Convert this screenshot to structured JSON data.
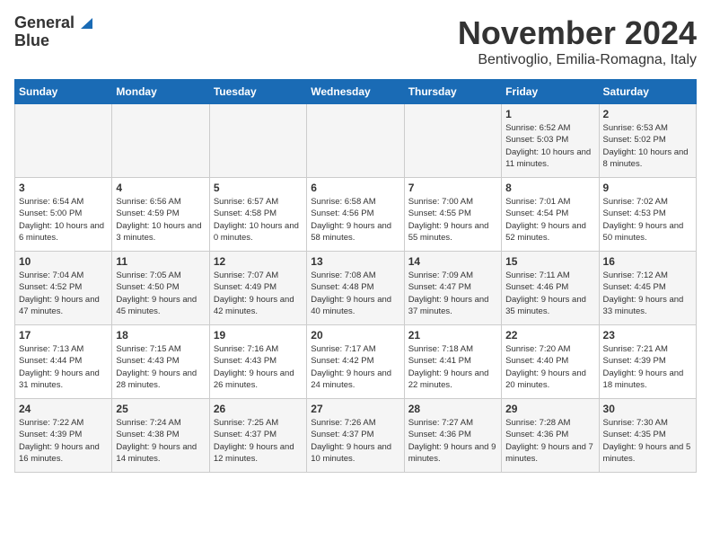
{
  "header": {
    "logo_line1": "General",
    "logo_line2": "Blue",
    "month": "November 2024",
    "location": "Bentivoglio, Emilia-Romagna, Italy"
  },
  "days_of_week": [
    "Sunday",
    "Monday",
    "Tuesday",
    "Wednesday",
    "Thursday",
    "Friday",
    "Saturday"
  ],
  "weeks": [
    [
      {
        "day": "",
        "info": ""
      },
      {
        "day": "",
        "info": ""
      },
      {
        "day": "",
        "info": ""
      },
      {
        "day": "",
        "info": ""
      },
      {
        "day": "",
        "info": ""
      },
      {
        "day": "1",
        "info": "Sunrise: 6:52 AM\nSunset: 5:03 PM\nDaylight: 10 hours and 11 minutes."
      },
      {
        "day": "2",
        "info": "Sunrise: 6:53 AM\nSunset: 5:02 PM\nDaylight: 10 hours and 8 minutes."
      }
    ],
    [
      {
        "day": "3",
        "info": "Sunrise: 6:54 AM\nSunset: 5:00 PM\nDaylight: 10 hours and 6 minutes."
      },
      {
        "day": "4",
        "info": "Sunrise: 6:56 AM\nSunset: 4:59 PM\nDaylight: 10 hours and 3 minutes."
      },
      {
        "day": "5",
        "info": "Sunrise: 6:57 AM\nSunset: 4:58 PM\nDaylight: 10 hours and 0 minutes."
      },
      {
        "day": "6",
        "info": "Sunrise: 6:58 AM\nSunset: 4:56 PM\nDaylight: 9 hours and 58 minutes."
      },
      {
        "day": "7",
        "info": "Sunrise: 7:00 AM\nSunset: 4:55 PM\nDaylight: 9 hours and 55 minutes."
      },
      {
        "day": "8",
        "info": "Sunrise: 7:01 AM\nSunset: 4:54 PM\nDaylight: 9 hours and 52 minutes."
      },
      {
        "day": "9",
        "info": "Sunrise: 7:02 AM\nSunset: 4:53 PM\nDaylight: 9 hours and 50 minutes."
      }
    ],
    [
      {
        "day": "10",
        "info": "Sunrise: 7:04 AM\nSunset: 4:52 PM\nDaylight: 9 hours and 47 minutes."
      },
      {
        "day": "11",
        "info": "Sunrise: 7:05 AM\nSunset: 4:50 PM\nDaylight: 9 hours and 45 minutes."
      },
      {
        "day": "12",
        "info": "Sunrise: 7:07 AM\nSunset: 4:49 PM\nDaylight: 9 hours and 42 minutes."
      },
      {
        "day": "13",
        "info": "Sunrise: 7:08 AM\nSunset: 4:48 PM\nDaylight: 9 hours and 40 minutes."
      },
      {
        "day": "14",
        "info": "Sunrise: 7:09 AM\nSunset: 4:47 PM\nDaylight: 9 hours and 37 minutes."
      },
      {
        "day": "15",
        "info": "Sunrise: 7:11 AM\nSunset: 4:46 PM\nDaylight: 9 hours and 35 minutes."
      },
      {
        "day": "16",
        "info": "Sunrise: 7:12 AM\nSunset: 4:45 PM\nDaylight: 9 hours and 33 minutes."
      }
    ],
    [
      {
        "day": "17",
        "info": "Sunrise: 7:13 AM\nSunset: 4:44 PM\nDaylight: 9 hours and 31 minutes."
      },
      {
        "day": "18",
        "info": "Sunrise: 7:15 AM\nSunset: 4:43 PM\nDaylight: 9 hours and 28 minutes."
      },
      {
        "day": "19",
        "info": "Sunrise: 7:16 AM\nSunset: 4:43 PM\nDaylight: 9 hours and 26 minutes."
      },
      {
        "day": "20",
        "info": "Sunrise: 7:17 AM\nSunset: 4:42 PM\nDaylight: 9 hours and 24 minutes."
      },
      {
        "day": "21",
        "info": "Sunrise: 7:18 AM\nSunset: 4:41 PM\nDaylight: 9 hours and 22 minutes."
      },
      {
        "day": "22",
        "info": "Sunrise: 7:20 AM\nSunset: 4:40 PM\nDaylight: 9 hours and 20 minutes."
      },
      {
        "day": "23",
        "info": "Sunrise: 7:21 AM\nSunset: 4:39 PM\nDaylight: 9 hours and 18 minutes."
      }
    ],
    [
      {
        "day": "24",
        "info": "Sunrise: 7:22 AM\nSunset: 4:39 PM\nDaylight: 9 hours and 16 minutes."
      },
      {
        "day": "25",
        "info": "Sunrise: 7:24 AM\nSunset: 4:38 PM\nDaylight: 9 hours and 14 minutes."
      },
      {
        "day": "26",
        "info": "Sunrise: 7:25 AM\nSunset: 4:37 PM\nDaylight: 9 hours and 12 minutes."
      },
      {
        "day": "27",
        "info": "Sunrise: 7:26 AM\nSunset: 4:37 PM\nDaylight: 9 hours and 10 minutes."
      },
      {
        "day": "28",
        "info": "Sunrise: 7:27 AM\nSunset: 4:36 PM\nDaylight: 9 hours and 9 minutes."
      },
      {
        "day": "29",
        "info": "Sunrise: 7:28 AM\nSunset: 4:36 PM\nDaylight: 9 hours and 7 minutes."
      },
      {
        "day": "30",
        "info": "Sunrise: 7:30 AM\nSunset: 4:35 PM\nDaylight: 9 hours and 5 minutes."
      }
    ]
  ]
}
